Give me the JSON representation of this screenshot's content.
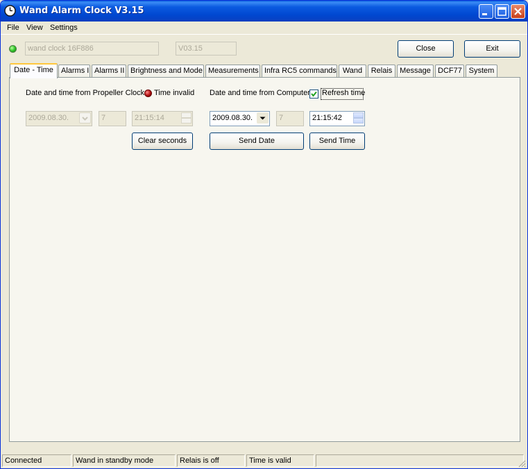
{
  "window": {
    "title": "Wand Alarm Clock V3.15"
  },
  "menu": [
    "File",
    "View",
    "Settings"
  ],
  "header": {
    "device_name": "wand clock 16F886",
    "version": "V03.15",
    "close_label": "Close",
    "exit_label": "Exit",
    "status_led_color": "#31c62a"
  },
  "tabs": [
    "Date - Time",
    "Alarms I",
    "Alarms II",
    "Brightness and Mode",
    "Measurements",
    "Infra RC5 commands",
    "Wand",
    "Relais",
    "Message",
    "DCF77",
    "System"
  ],
  "active_tab": "Date - Time",
  "propeller": {
    "label": "Date and time from Propeller Clock:",
    "status": "Time invalid",
    "status_led_color": "#b01010",
    "date": "2009.08.30.",
    "day": "7",
    "time": "21:15:14",
    "clear_label": "Clear seconds"
  },
  "computer": {
    "label": "Date and time from Computer:",
    "refresh_label": "Refresh time",
    "refresh_checked": true,
    "date": "2009.08.30.",
    "day": "7",
    "time": "21:15:42",
    "send_date_label": "Send Date",
    "send_time_label": "Send Time"
  },
  "status": [
    "Connected",
    "Wand in standby mode",
    "Relais is off",
    "Time is valid",
    ""
  ]
}
